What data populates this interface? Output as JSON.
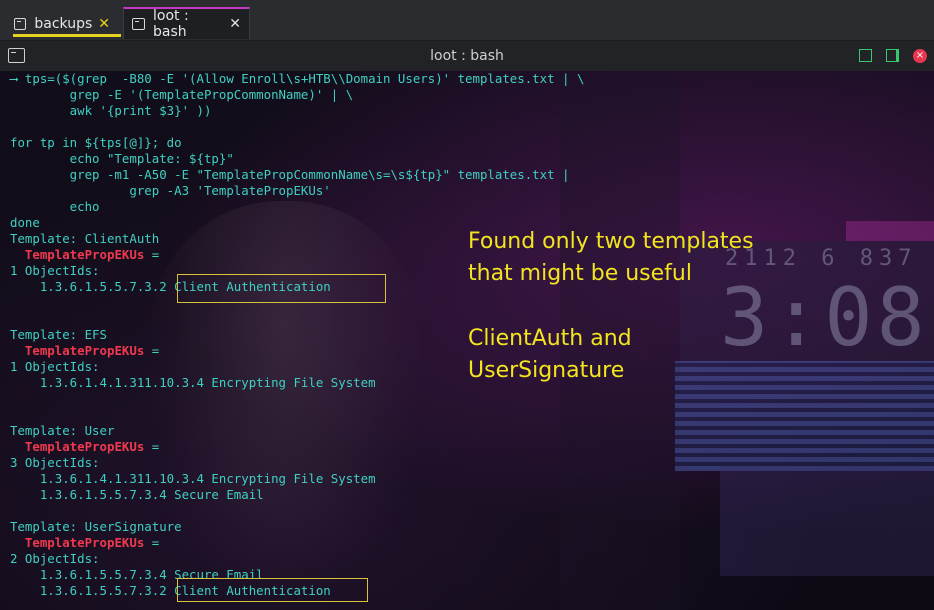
{
  "tabs": [
    {
      "label": "backups",
      "close": "✕",
      "active": false
    },
    {
      "label": "loot : bash",
      "close": "✕",
      "active": true
    }
  ],
  "window": {
    "title": "loot : bash",
    "close_glyph": "×"
  },
  "terminal": {
    "lines": [
      "⟶ tps=($(grep  -B80 -E '(Allow Enroll\\s+HTB\\\\Domain Users)' templates.txt | \\",
      "        grep -E '(TemplatePropCommonName)' | \\",
      "        awk '{print $3}' ))",
      "",
      "for tp in ${tps[@]}; do",
      "        echo \"Template: ${tp}\"",
      "        grep -m1 -A50 -E \"TemplatePropCommonName\\s=\\s${tp}\" templates.txt |",
      "                grep -A3 'TemplatePropEKUs'",
      "        echo",
      "done",
      "Template: ClientAuth",
      "  TemplatePropEKUs =",
      "1 ObjectIds:",
      "    1.3.6.1.5.5.7.3.2 Client Authentication",
      "",
      "",
      "Template: EFS",
      "  TemplatePropEKUs =",
      "1 ObjectIds:",
      "    1.3.6.1.4.1.311.10.3.4 Encrypting File System",
      "",
      "",
      "Template: User",
      "  TemplatePropEKUs =",
      "3 ObjectIds:",
      "    1.3.6.1.4.1.311.10.3.4 Encrypting File System",
      "    1.3.6.1.5.5.7.3.4 Secure Email",
      "",
      "Template: UserSignature",
      "  TemplatePropEKUs =",
      "2 ObjectIds:",
      "    1.3.6.1.5.5.7.3.4 Secure Email",
      "    1.3.6.1.5.5.7.3.2 Client Authentication"
    ],
    "highlighted_keyword": "TemplatePropEKUs =",
    "text_color": "#3fd0c2",
    "highlight_color": "#f0394f"
  },
  "annotations": {
    "note1_line1": "Found only two templates",
    "note1_line2": "that might be useful",
    "note2_line1": "ClientAuth and",
    "note2_line2": "UserSignature",
    "color": "#f2e41e"
  },
  "wallpaper": {
    "clock_text": "3:08",
    "small_digits": "2112  6 837"
  },
  "colors": {
    "tab_underline": "#e6d21e",
    "active_tab_top": "#c33bc4",
    "window_controls": "#37c86e",
    "close_button": "#e8364f"
  }
}
